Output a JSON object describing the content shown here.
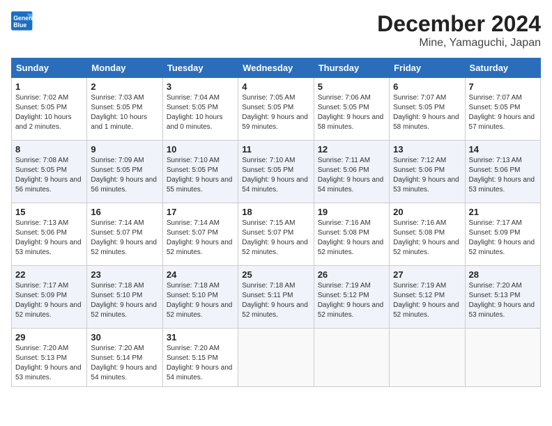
{
  "header": {
    "logo_line1": "General",
    "logo_line2": "Blue",
    "month": "December 2024",
    "location": "Mine, Yamaguchi, Japan"
  },
  "days_of_week": [
    "Sunday",
    "Monday",
    "Tuesday",
    "Wednesday",
    "Thursday",
    "Friday",
    "Saturday"
  ],
  "weeks": [
    [
      {
        "num": "1",
        "sunrise": "7:02 AM",
        "sunset": "5:05 PM",
        "daylight": "10 hours and 2 minutes."
      },
      {
        "num": "2",
        "sunrise": "7:03 AM",
        "sunset": "5:05 PM",
        "daylight": "10 hours and 1 minute."
      },
      {
        "num": "3",
        "sunrise": "7:04 AM",
        "sunset": "5:05 PM",
        "daylight": "10 hours and 0 minutes."
      },
      {
        "num": "4",
        "sunrise": "7:05 AM",
        "sunset": "5:05 PM",
        "daylight": "9 hours and 59 minutes."
      },
      {
        "num": "5",
        "sunrise": "7:06 AM",
        "sunset": "5:05 PM",
        "daylight": "9 hours and 58 minutes."
      },
      {
        "num": "6",
        "sunrise": "7:07 AM",
        "sunset": "5:05 PM",
        "daylight": "9 hours and 58 minutes."
      },
      {
        "num": "7",
        "sunrise": "7:07 AM",
        "sunset": "5:05 PM",
        "daylight": "9 hours and 57 minutes."
      }
    ],
    [
      {
        "num": "8",
        "sunrise": "7:08 AM",
        "sunset": "5:05 PM",
        "daylight": "9 hours and 56 minutes."
      },
      {
        "num": "9",
        "sunrise": "7:09 AM",
        "sunset": "5:05 PM",
        "daylight": "9 hours and 56 minutes."
      },
      {
        "num": "10",
        "sunrise": "7:10 AM",
        "sunset": "5:05 PM",
        "daylight": "9 hours and 55 minutes."
      },
      {
        "num": "11",
        "sunrise": "7:10 AM",
        "sunset": "5:05 PM",
        "daylight": "9 hours and 54 minutes."
      },
      {
        "num": "12",
        "sunrise": "7:11 AM",
        "sunset": "5:06 PM",
        "daylight": "9 hours and 54 minutes."
      },
      {
        "num": "13",
        "sunrise": "7:12 AM",
        "sunset": "5:06 PM",
        "daylight": "9 hours and 53 minutes."
      },
      {
        "num": "14",
        "sunrise": "7:13 AM",
        "sunset": "5:06 PM",
        "daylight": "9 hours and 53 minutes."
      }
    ],
    [
      {
        "num": "15",
        "sunrise": "7:13 AM",
        "sunset": "5:06 PM",
        "daylight": "9 hours and 53 minutes."
      },
      {
        "num": "16",
        "sunrise": "7:14 AM",
        "sunset": "5:07 PM",
        "daylight": "9 hours and 52 minutes."
      },
      {
        "num": "17",
        "sunrise": "7:14 AM",
        "sunset": "5:07 PM",
        "daylight": "9 hours and 52 minutes."
      },
      {
        "num": "18",
        "sunrise": "7:15 AM",
        "sunset": "5:07 PM",
        "daylight": "9 hours and 52 minutes."
      },
      {
        "num": "19",
        "sunrise": "7:16 AM",
        "sunset": "5:08 PM",
        "daylight": "9 hours and 52 minutes."
      },
      {
        "num": "20",
        "sunrise": "7:16 AM",
        "sunset": "5:08 PM",
        "daylight": "9 hours and 52 minutes."
      },
      {
        "num": "21",
        "sunrise": "7:17 AM",
        "sunset": "5:09 PM",
        "daylight": "9 hours and 52 minutes."
      }
    ],
    [
      {
        "num": "22",
        "sunrise": "7:17 AM",
        "sunset": "5:09 PM",
        "daylight": "9 hours and 52 minutes."
      },
      {
        "num": "23",
        "sunrise": "7:18 AM",
        "sunset": "5:10 PM",
        "daylight": "9 hours and 52 minutes."
      },
      {
        "num": "24",
        "sunrise": "7:18 AM",
        "sunset": "5:10 PM",
        "daylight": "9 hours and 52 minutes."
      },
      {
        "num": "25",
        "sunrise": "7:18 AM",
        "sunset": "5:11 PM",
        "daylight": "9 hours and 52 minutes."
      },
      {
        "num": "26",
        "sunrise": "7:19 AM",
        "sunset": "5:12 PM",
        "daylight": "9 hours and 52 minutes."
      },
      {
        "num": "27",
        "sunrise": "7:19 AM",
        "sunset": "5:12 PM",
        "daylight": "9 hours and 52 minutes."
      },
      {
        "num": "28",
        "sunrise": "7:20 AM",
        "sunset": "5:13 PM",
        "daylight": "9 hours and 53 minutes."
      }
    ],
    [
      {
        "num": "29",
        "sunrise": "7:20 AM",
        "sunset": "5:13 PM",
        "daylight": "9 hours and 53 minutes."
      },
      {
        "num": "30",
        "sunrise": "7:20 AM",
        "sunset": "5:14 PM",
        "daylight": "9 hours and 54 minutes."
      },
      {
        "num": "31",
        "sunrise": "7:20 AM",
        "sunset": "5:15 PM",
        "daylight": "9 hours and 54 minutes."
      },
      null,
      null,
      null,
      null
    ]
  ]
}
